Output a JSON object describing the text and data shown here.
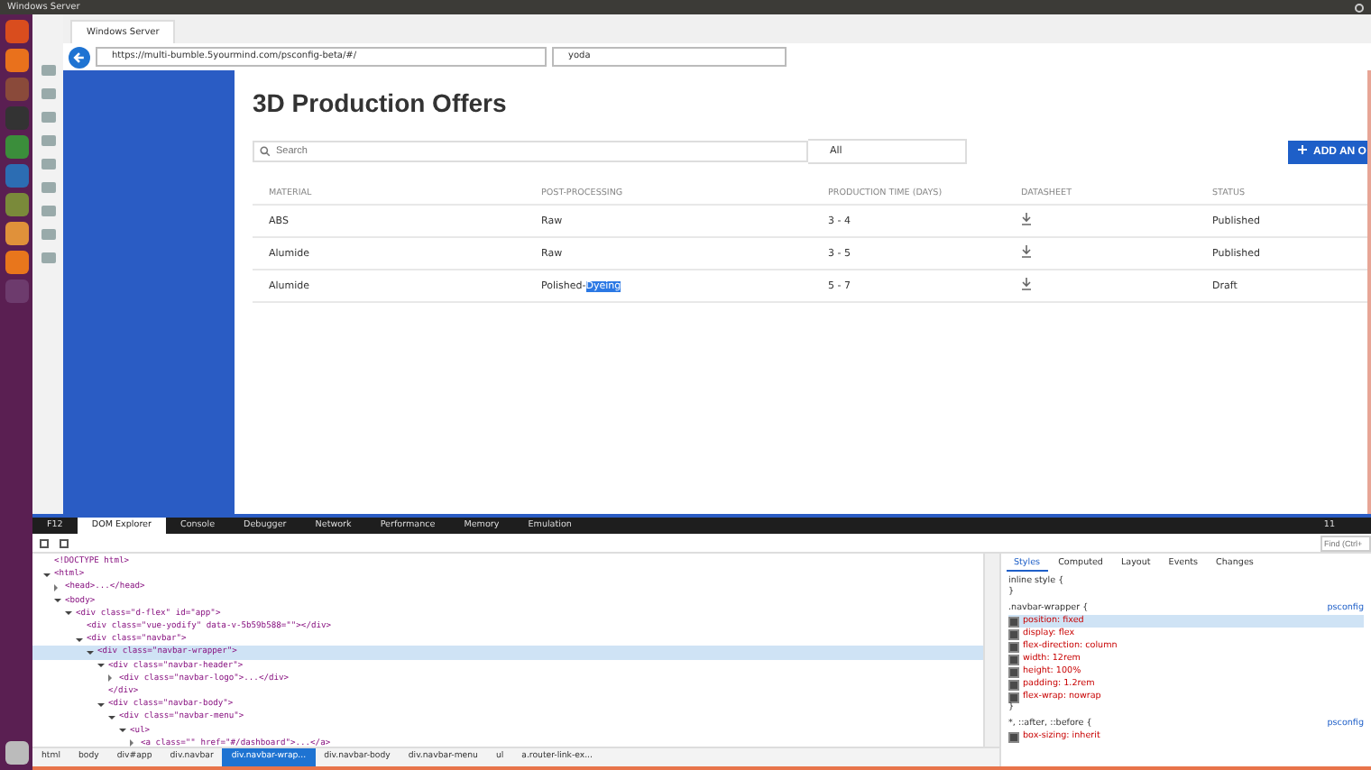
{
  "os_bar": {
    "title": "Windows Server"
  },
  "browser": {
    "tab_title": "Windows Server",
    "url": "https://multi-bumble.5yourmind.com/psconfig-beta/#/",
    "search_value": "yoda"
  },
  "page": {
    "title": "3D Production Offers",
    "search": {
      "placeholder": "Search"
    },
    "filter": {
      "value": "All"
    },
    "add_button": "ADD AN O",
    "table": {
      "columns": [
        "MATERIAL",
        "POST-PROCESSING",
        "PRODUCTION TIME (DAYS)",
        "DATASHEET",
        "STATUS"
      ],
      "rows": [
        {
          "material": "ABS",
          "post_processing": "Raw",
          "time": "3 - 4",
          "status": "Published"
        },
        {
          "material": "Alumide",
          "post_processing": "Raw",
          "time": "3 - 5",
          "status": "Published"
        },
        {
          "material": "Alumide",
          "post_processing": "Polished-",
          "selected_text": "Dyeing",
          "time": "5 - 7",
          "status": "Draft"
        }
      ]
    }
  },
  "devtools": {
    "tabs": [
      {
        "label": "F12",
        "selected": false
      },
      {
        "label": "DOM Explorer",
        "selected": true
      },
      {
        "label": "Console",
        "selected": false
      },
      {
        "label": "Debugger",
        "selected": false
      },
      {
        "label": "Network",
        "selected": false
      },
      {
        "label": "Performance",
        "selected": false
      },
      {
        "label": "Memory",
        "selected": false
      },
      {
        "label": "Emulation",
        "selected": false
      }
    ],
    "count": "11",
    "find_placeholder": "Find (Ctrl+",
    "dom_tree": [
      {
        "text": "<!DOCTYPE html>",
        "selected": false
      },
      {
        "text": "<html>",
        "expanded": true,
        "selected": false,
        "children": [
          {
            "text": "<head>...</head>",
            "expanded": false,
            "selected": false
          },
          {
            "text": "<body>",
            "expanded": true,
            "selected": false,
            "children": [
              {
                "text": "<div class=\"d-flex\" id=\"app\">",
                "expanded": true,
                "selected": false,
                "children": [
                  {
                    "text": "<div class=\"vue-yodify\" data-v-5b59b588=\"\"></div>",
                    "selected": false
                  },
                  {
                    "text": "<div class=\"navbar\">",
                    "expanded": true,
                    "selected": false,
                    "children": [
                      {
                        "text": "<div class=\"navbar-wrapper\">",
                        "expanded": true,
                        "selected": true,
                        "children": [
                          {
                            "text": "<div class=\"navbar-header\">",
                            "expanded": true,
                            "selected": false,
                            "children": [
                              {
                                "text": "<div class=\"navbar-logo\">...</div>",
                                "expanded": false,
                                "selected": false
                              }
                            ]
                          },
                          {
                            "text": "</div>",
                            "selected": false
                          },
                          {
                            "text": "<div class=\"navbar-body\">",
                            "expanded": true,
                            "selected": false,
                            "children": [
                              {
                                "text": "<div class=\"navbar-menu\">",
                                "expanded": true,
                                "selected": false,
                                "children": [
                                  {
                                    "text": "<ul>",
                                    "expanded": true,
                                    "selected": false,
                                    "children": [
                                      {
                                        "text": "<a class=\"\" href=\"#/dashboard\">...</a>",
                                        "expanded": false,
                                        "selected": false
                                      }
                                    ]
                                  }
                                ]
                              }
                            ]
                          }
                        ]
                      }
                    ]
                  }
                ]
              }
            ]
          }
        ]
      }
    ],
    "style_tabs": [
      {
        "label": "Styles",
        "selected": true
      },
      {
        "label": "Computed",
        "selected": false
      },
      {
        "label": "Layout",
        "selected": false
      },
      {
        "label": "Events",
        "selected": false
      },
      {
        "label": "Changes",
        "selected": false
      }
    ],
    "rules": [
      {
        "selector": "inline style {",
        "close": "}"
      },
      {
        "selector": ".navbar-wrapper {",
        "source": "psconfig",
        "declarations": [
          {
            "text": "position: fixed",
            "checked": true,
            "selected": true
          },
          {
            "text": "display: flex",
            "checked": true,
            "selected": false
          },
          {
            "text": "flex-direction: column",
            "checked": true,
            "selected": false
          },
          {
            "text": "width: 12rem",
            "checked": true,
            "selected": false
          },
          {
            "text": "height: 100%",
            "checked": true,
            "selected": false
          },
          {
            "text": "padding: 1.2rem",
            "checked": true,
            "selected": false
          },
          {
            "text": "flex-wrap: nowrap",
            "checked": true,
            "selected": false
          }
        ],
        "close": "}"
      },
      {
        "selector": "*, ::after, ::before {",
        "source": "psconfig",
        "declarations": [
          {
            "text": "box-sizing: inherit",
            "checked": true,
            "selected": false
          }
        ]
      }
    ],
    "breadcrumb": [
      {
        "label": "html",
        "selected": false
      },
      {
        "label": "body",
        "selected": false
      },
      {
        "label": "div#app",
        "selected": false
      },
      {
        "label": "div.navbar",
        "selected": false
      },
      {
        "label": "div.navbar-wrap...",
        "selected": true
      },
      {
        "label": "div.navbar-body",
        "selected": false
      },
      {
        "label": "div.navbar-menu",
        "selected": false
      },
      {
        "label": "ul",
        "selected": false
      },
      {
        "label": "a.router-link-ex...",
        "selected": false
      }
    ]
  }
}
